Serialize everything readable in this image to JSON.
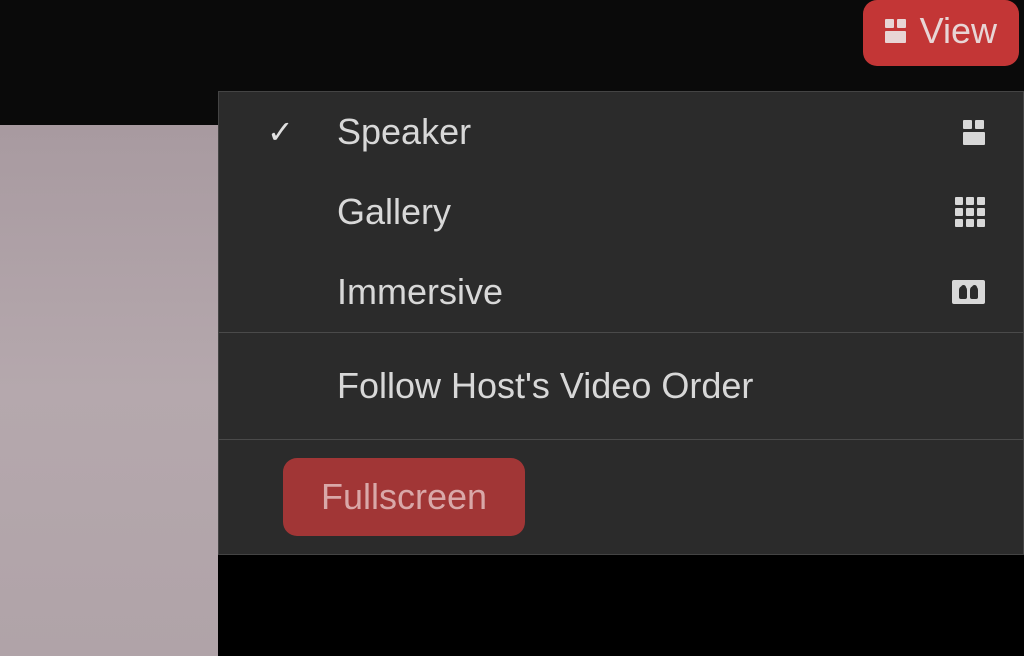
{
  "topbar": {
    "view_button_label": "View"
  },
  "menu": {
    "items": [
      {
        "label": "Speaker",
        "checked": true,
        "icon": "speaker-layout-icon"
      },
      {
        "label": "Gallery",
        "checked": false,
        "icon": "gallery-layout-icon"
      },
      {
        "label": "Immersive",
        "checked": false,
        "icon": "immersive-layout-icon"
      }
    ],
    "follow_host_label": "Follow Host's Video Order",
    "fullscreen_label": "Fullscreen"
  },
  "colors": {
    "highlight": "#c33636",
    "menu_bg": "#2b2b2b",
    "text": "#d8d8d8"
  }
}
